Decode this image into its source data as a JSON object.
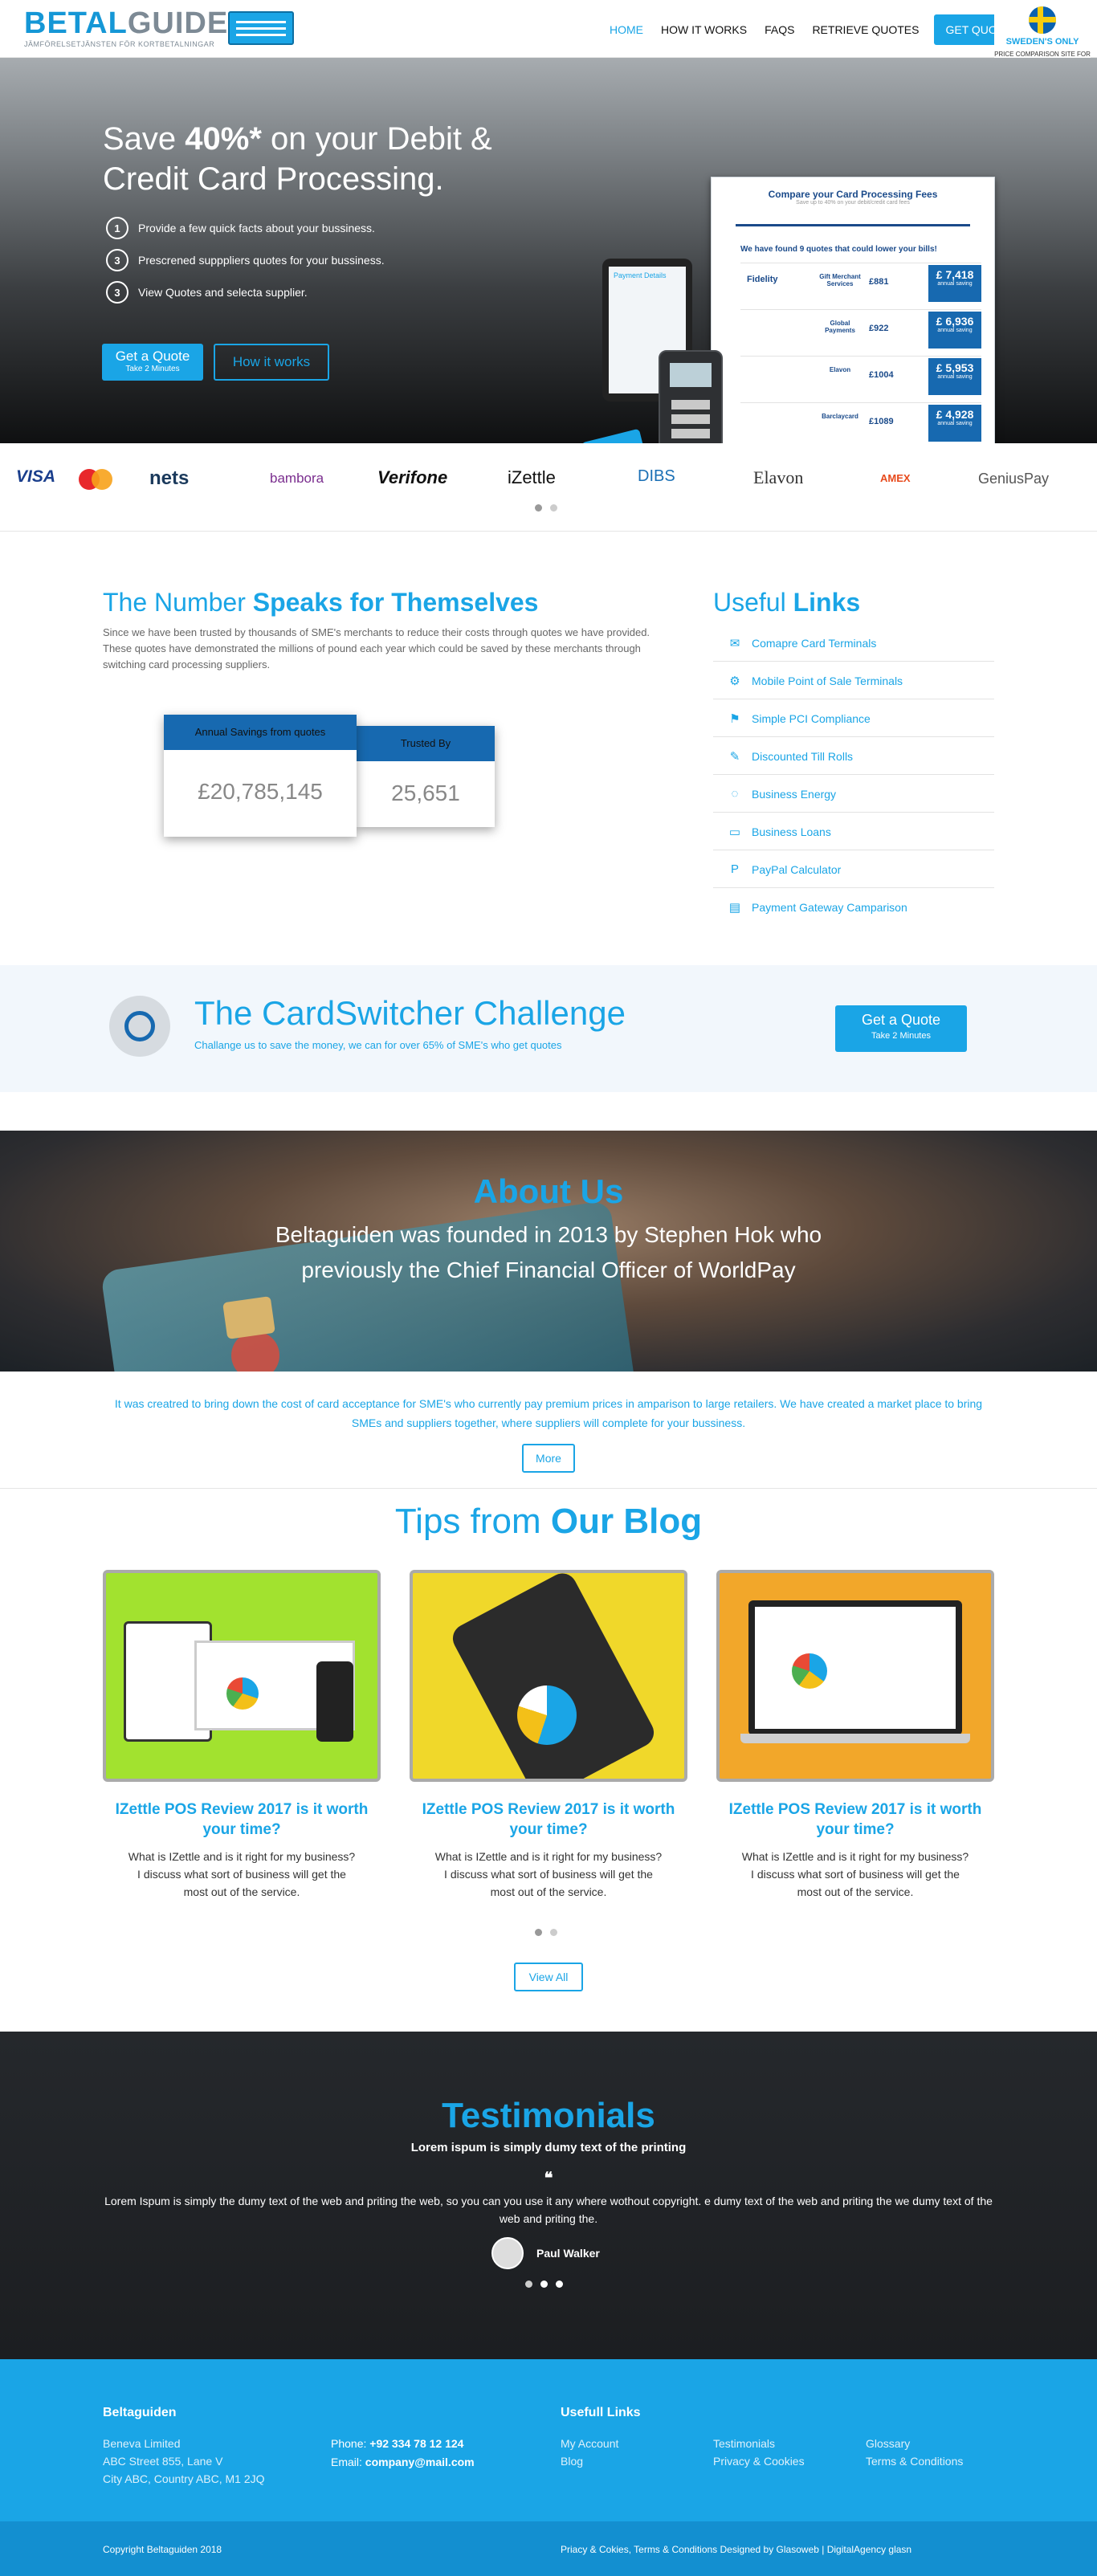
{
  "header": {
    "logo_main": "BETAL",
    "logo_accent": "GUIDEN",
    "logo_tagline": "JÄMFÖRELSETJÄNSTEN FÖR KORTBETALNINGAR",
    "nav": [
      "HOME",
      "HOW IT WORKS",
      "FAQS",
      "RETRIEVE QUOTES"
    ],
    "cta": "GET QUOTES",
    "badge_title": "SWEDEN'S ONLY",
    "badge_text": "PRICE COMPARISON SITE FOR CARD PROCESSING"
  },
  "hero": {
    "title_pre": "Save ",
    "title_bold": "40%*",
    "title_post": " on your Debit & Credit Card Processing.",
    "steps": [
      {
        "n": "1",
        "text": "Provide a few quick facts about your bussiness."
      },
      {
        "n": "3",
        "text": "Prescrened supppliers quotes for your bussiness."
      },
      {
        "n": "3",
        "text": "View Quotes and selecta supplier."
      }
    ],
    "quote_btn": "Get a Quote",
    "quote_btn_sub": "Take 2 Minutes",
    "how_btn": "How it works",
    "mock": {
      "title": "Compare your Card Processing Fees",
      "subtitle": "Save up to 40% on your debit/credit card fees",
      "found": "We have found 9 quotes that could lower your bills!",
      "tablet_title": "Payment Details",
      "rows": [
        {
          "logo": "Fidelity",
          "provider": "Gift Merchant Services",
          "price": "£881",
          "saving": "£ 7,418",
          "saving_label": "annual saving"
        },
        {
          "logo": "",
          "provider": "Global Payments",
          "price": "£922",
          "saving": "£ 6,936",
          "saving_label": "annual saving"
        },
        {
          "logo": "",
          "provider": "Elavon",
          "price": "£1004",
          "saving": "£ 5,953",
          "saving_label": "annual saving"
        },
        {
          "logo": "",
          "provider": "Barclaycard",
          "price": "£1089",
          "saving": "£ 4,928",
          "saving_label": "annual saving"
        }
      ]
    }
  },
  "logos": [
    "VISA",
    "nets",
    "bambora",
    "Verifone",
    "iZettle",
    "DIBS",
    "Elavon",
    "AMEX",
    "GeniusPay"
  ],
  "numbers": {
    "title_light": "The Number ",
    "title_bold": "Speaks for Themselves",
    "text": "Since we have been trusted by thousands of SME's merchants to reduce their costs through quotes we have provided. These quotes have demonstrated the millions of pound each year which could be saved by these merchants through switching card processing suppliers.",
    "stat1_label": "Annual Savings from quotes",
    "stat1_value": "£20,785,145",
    "stat2_label": "Trusted By",
    "stat2_value": "25,651"
  },
  "useful_links": {
    "title_light": "Useful ",
    "title_bold": "Links",
    "items": [
      {
        "icon": "envelope-icon",
        "glyph": "✉",
        "label": "Comapre Card Terminals"
      },
      {
        "icon": "gear-icon",
        "glyph": "⚙",
        "label": "Mobile Point of Sale Terminals"
      },
      {
        "icon": "flag-icon",
        "glyph": "⚑",
        "label": "Simple PCI Compliance"
      },
      {
        "icon": "pencil-icon",
        "glyph": "✎",
        "label": "Discounted Till Rolls"
      },
      {
        "icon": "chat-icon",
        "glyph": "◌",
        "label": "Business Energy"
      },
      {
        "icon": "battery-icon",
        "glyph": "▭",
        "label": "Business Loans"
      },
      {
        "icon": "paypal-icon",
        "glyph": "P",
        "label": "PayPal Calculator"
      },
      {
        "icon": "book-icon",
        "glyph": "▤",
        "label": "Payment Gateway Camparison"
      }
    ]
  },
  "challenge": {
    "title": "The CardSwitcher Challenge",
    "text": "Challange us to save the money, we can for over 65% of SME's who get quotes",
    "btn": "Get a Quote",
    "btn_sub": "Take 2 Minutes"
  },
  "about": {
    "title": "About Us",
    "lead": "Beltaguiden was founded in 2013 by Stephen Hok who previously the Chief Financial Officer of WorldPay",
    "text": "It was creatred to bring down the cost of card acceptance for SME's who currently pay premium prices in amparison to large retailers. We have created a market place to bring SMEs and suppliers together, where suppliers will complete for your bussiness.",
    "more": "More"
  },
  "blog": {
    "title_light": "Tips from ",
    "title_bold": "Our Blog",
    "posts": [
      {
        "title": "IZettle POS Review 2017 is it worth your time?",
        "text": "What is IZettle and is it right for my business? I discuss what sort of business will get the most out of the service.",
        "bg": "#a2e22f"
      },
      {
        "title": "IZettle POS Review 2017 is it worth your time?",
        "text": "What is IZettle and is it right for my business? I discuss what sort of business will get the most out of the service.",
        "bg": "#f0d82a"
      },
      {
        "title": "IZettle POS Review 2017 is it worth your time?",
        "text": "What is IZettle and is it right for my business? I discuss what sort of business will get the most out of the service.",
        "bg": "#f2a72a"
      }
    ],
    "view_all": "View All"
  },
  "testimonials": {
    "title": "Testimonials",
    "subtitle": "Lorem ispum is simply dumy text of the printing",
    "quote_mark": "❝",
    "body": "Lorem Ispum is simply the dumy text of the web and priting the web, so you can you use it any where wothout copyright. e dumy text of the web and priting the we dumy text of the web and priting the.",
    "name": "Paul Walker"
  },
  "footer": {
    "brand": "Beltaguiden",
    "address": [
      "Beneva Limited",
      "ABC Street 855, Lane V",
      "City ABC, Country ABC, M1 2JQ"
    ],
    "phone_label": "Phone: ",
    "phone": "+92 334 78 12 124",
    "email_label": "Email: ",
    "email": "company@mail.com",
    "links_title": "Usefull Links",
    "col1": [
      "My Account",
      "Blog"
    ],
    "col2": [
      "Testimonials",
      "Privacy & Cookies"
    ],
    "col3": [
      "Glossary",
      "Terms & Conditions"
    ],
    "copyright": "Copyright Beltaguiden 2018",
    "credits": "Priacy & Cokies, Terms & Conditions Designed by Glasoweb | DigitalAgency glasn"
  },
  "colors": {
    "accent": "#1aa5e6",
    "dark_blue": "#1769b0",
    "footer": "#1aa5e6"
  }
}
